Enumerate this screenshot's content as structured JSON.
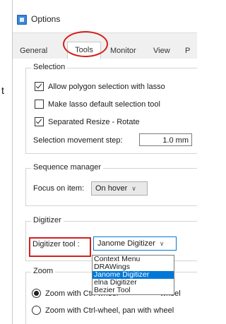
{
  "stray_text": "t",
  "window": {
    "title": "Options"
  },
  "tabs": [
    "General",
    "Tools",
    "Monitor",
    "View",
    "P"
  ],
  "selection": {
    "legend": "Selection",
    "allow_lasso": {
      "label": "Allow polygon selection with lasso",
      "checked": true
    },
    "lasso_default": {
      "label": "Make lasso default selection tool",
      "checked": false
    },
    "separated_resize": {
      "label": "Separated Resize - Rotate",
      "checked": true
    },
    "movement_step_label": "Selection movement step:",
    "movement_step_value": "1.0 mm"
  },
  "sequence_manager": {
    "legend": "Sequence manager",
    "focus_label": "Focus on item:",
    "focus_value": "On hover"
  },
  "digitizer": {
    "legend": "Digitizer",
    "tool_label": "Digitizer tool :",
    "tool_value": "Janome Digitizer",
    "options": [
      "Context Menu",
      "DRAWings",
      "Janome Digitizer",
      "elna Digitizer",
      "Bezier Tool"
    ],
    "selected_option": "Janome Digitizer"
  },
  "zoom": {
    "legend": "Zoom",
    "option1": {
      "label": "Zoom with Ctrl-wheel",
      "selected": true,
      "suffix": "wheel"
    },
    "option2": {
      "label": "Zoom with Ctrl-wheel, pan with wheel",
      "selected": false
    }
  },
  "colors": {
    "highlight": "#d4201a",
    "selection": "#0078d7"
  }
}
